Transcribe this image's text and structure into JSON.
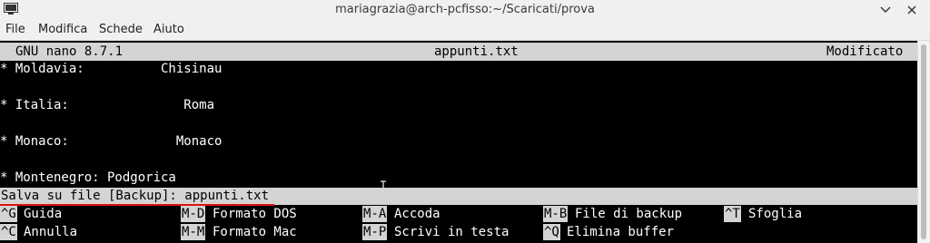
{
  "window": {
    "title": "mariagrazia@arch-pcfisso:~/Scaricati/prova",
    "icons": [
      "terminal-app-icon",
      "minimize-icon",
      "close-icon"
    ]
  },
  "menu": {
    "items": [
      "File",
      "Modifica",
      "Schede",
      "Aiuto"
    ]
  },
  "nano": {
    "version": "GNU nano 8.7.1",
    "filename": "appunti.txt",
    "status": "Modificato"
  },
  "content": {
    "lines": [
      "* Moldavia:          Chisinau",
      "",
      "* Italia:               Roma",
      "",
      "* Monaco:              Monaco",
      "",
      "* Montenegro: Podgorica"
    ]
  },
  "prompt": {
    "text": "Salva su file [Backup]: appunti.txt"
  },
  "shortcuts": [
    {
      "key": "^G",
      "label": "Guida"
    },
    {
      "key": "M-D",
      "label": "Formato DOS"
    },
    {
      "key": "M-A",
      "label": "Accoda"
    },
    {
      "key": "M-B",
      "label": "File di backup"
    },
    {
      "key": "^T",
      "label": "Sfoglia"
    },
    {
      "key": "^C",
      "label": "Annulla"
    },
    {
      "key": "M-M",
      "label": "Formato Mac"
    },
    {
      "key": "M-P",
      "label": "Scrivi in testa"
    },
    {
      "key": "^Q",
      "label": "Elimina buffer"
    }
  ],
  "colors": {
    "terminal_bg": "#000000",
    "terminal_fg": "#ffffff",
    "bar_bg": "#d4d4d4",
    "prompt_underline": "#dd1111"
  }
}
